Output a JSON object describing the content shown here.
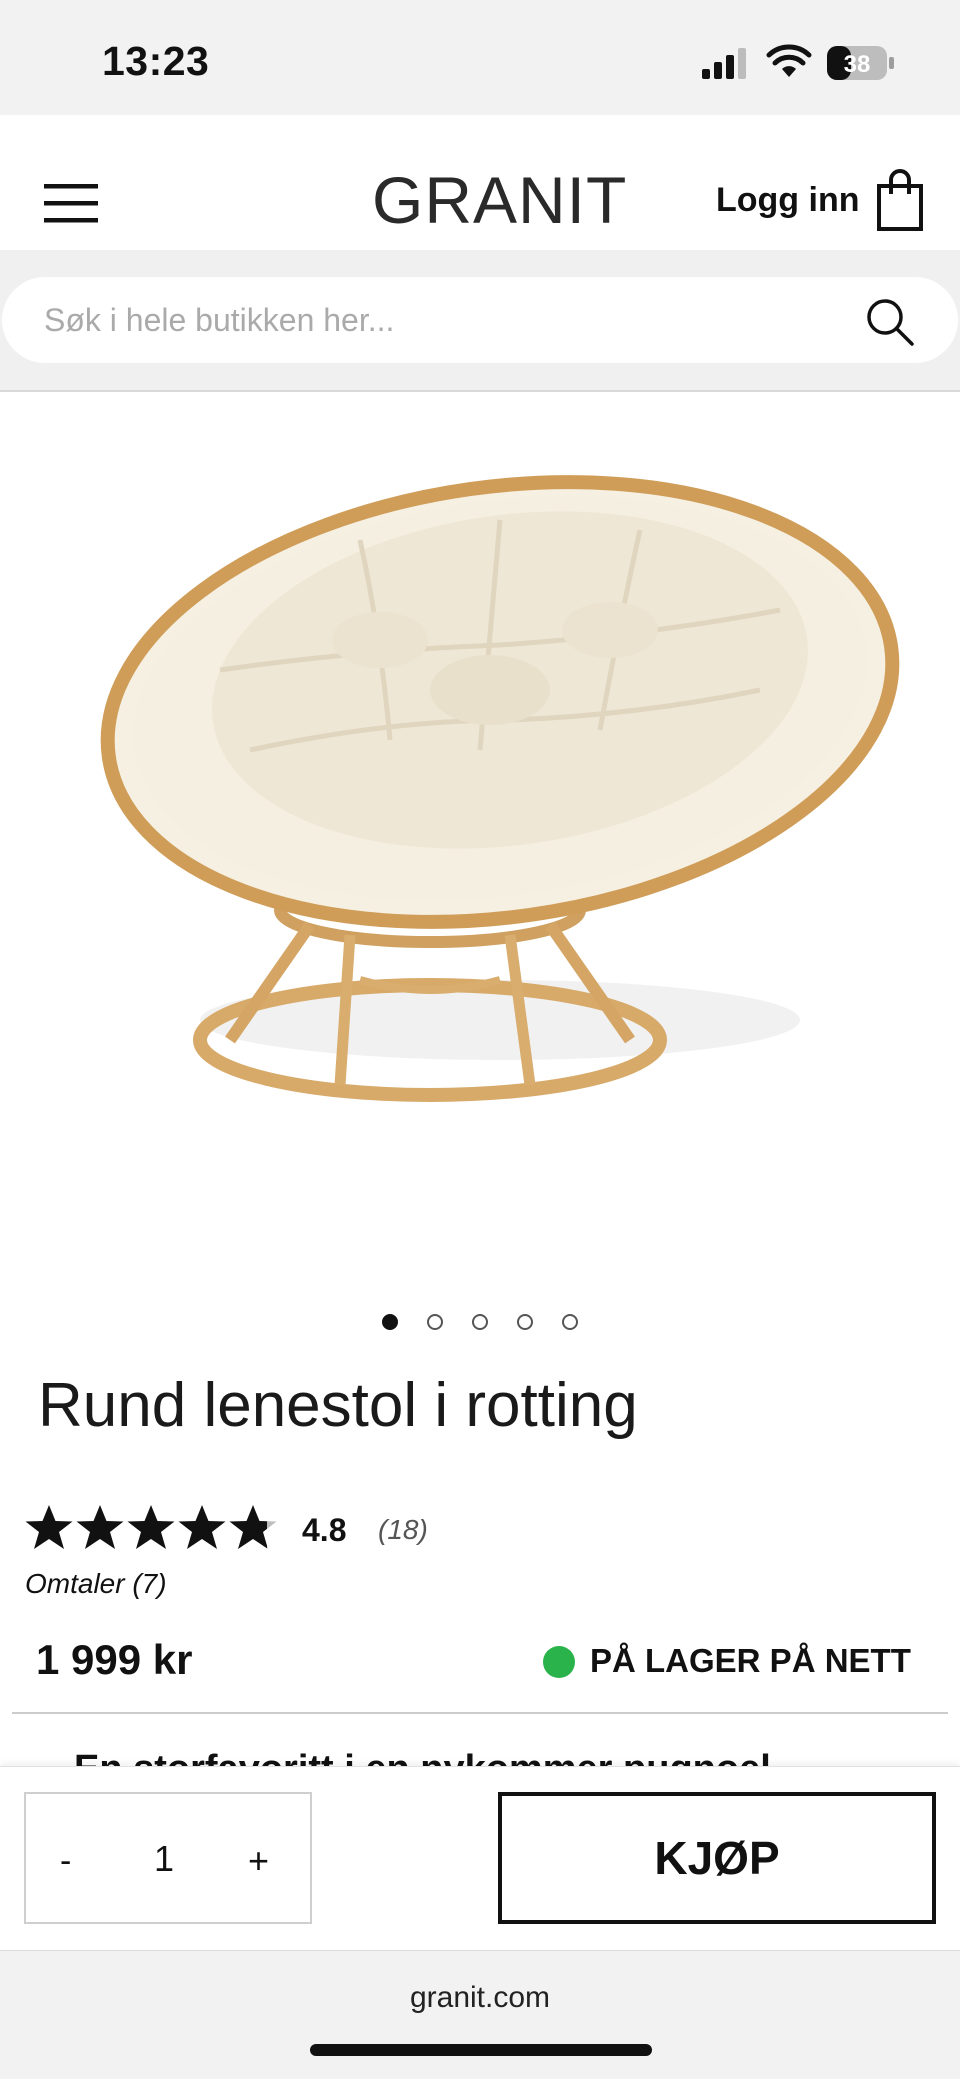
{
  "status_bar": {
    "time": "13:23",
    "battery_level": "38",
    "signal_icon": "cellular-signal-icon",
    "wifi_icon": "wifi-icon"
  },
  "header": {
    "menu_icon": "hamburger-menu-icon",
    "logo": "GRANIT",
    "login_label": "Logg inn",
    "cart_icon": "shopping-bag-icon"
  },
  "search": {
    "placeholder": "Søk i hele butikken her...",
    "value": "",
    "icon": "search-icon"
  },
  "gallery": {
    "image_subject": "rattan papasan chair with cream cushion",
    "slide_count": 5,
    "active_index": 0
  },
  "product": {
    "title": "Rund lenestol i rotting",
    "rating_value": "4.8",
    "rating_stars": 4.8,
    "rating_max": 5,
    "rating_count": "(18)",
    "reviews_label": "Omtaler (7)",
    "price": "1 999 kr",
    "stock_label": "PÅ LAGER PÅ NETT",
    "stock_color": "#2ab34a",
    "teaser": "En storfavoritt i en nykommer pugnoel"
  },
  "purchase": {
    "minus_label": "-",
    "quantity": "1",
    "plus_label": "+",
    "buy_label": "KJØP"
  },
  "browser": {
    "url": "granit.com"
  }
}
